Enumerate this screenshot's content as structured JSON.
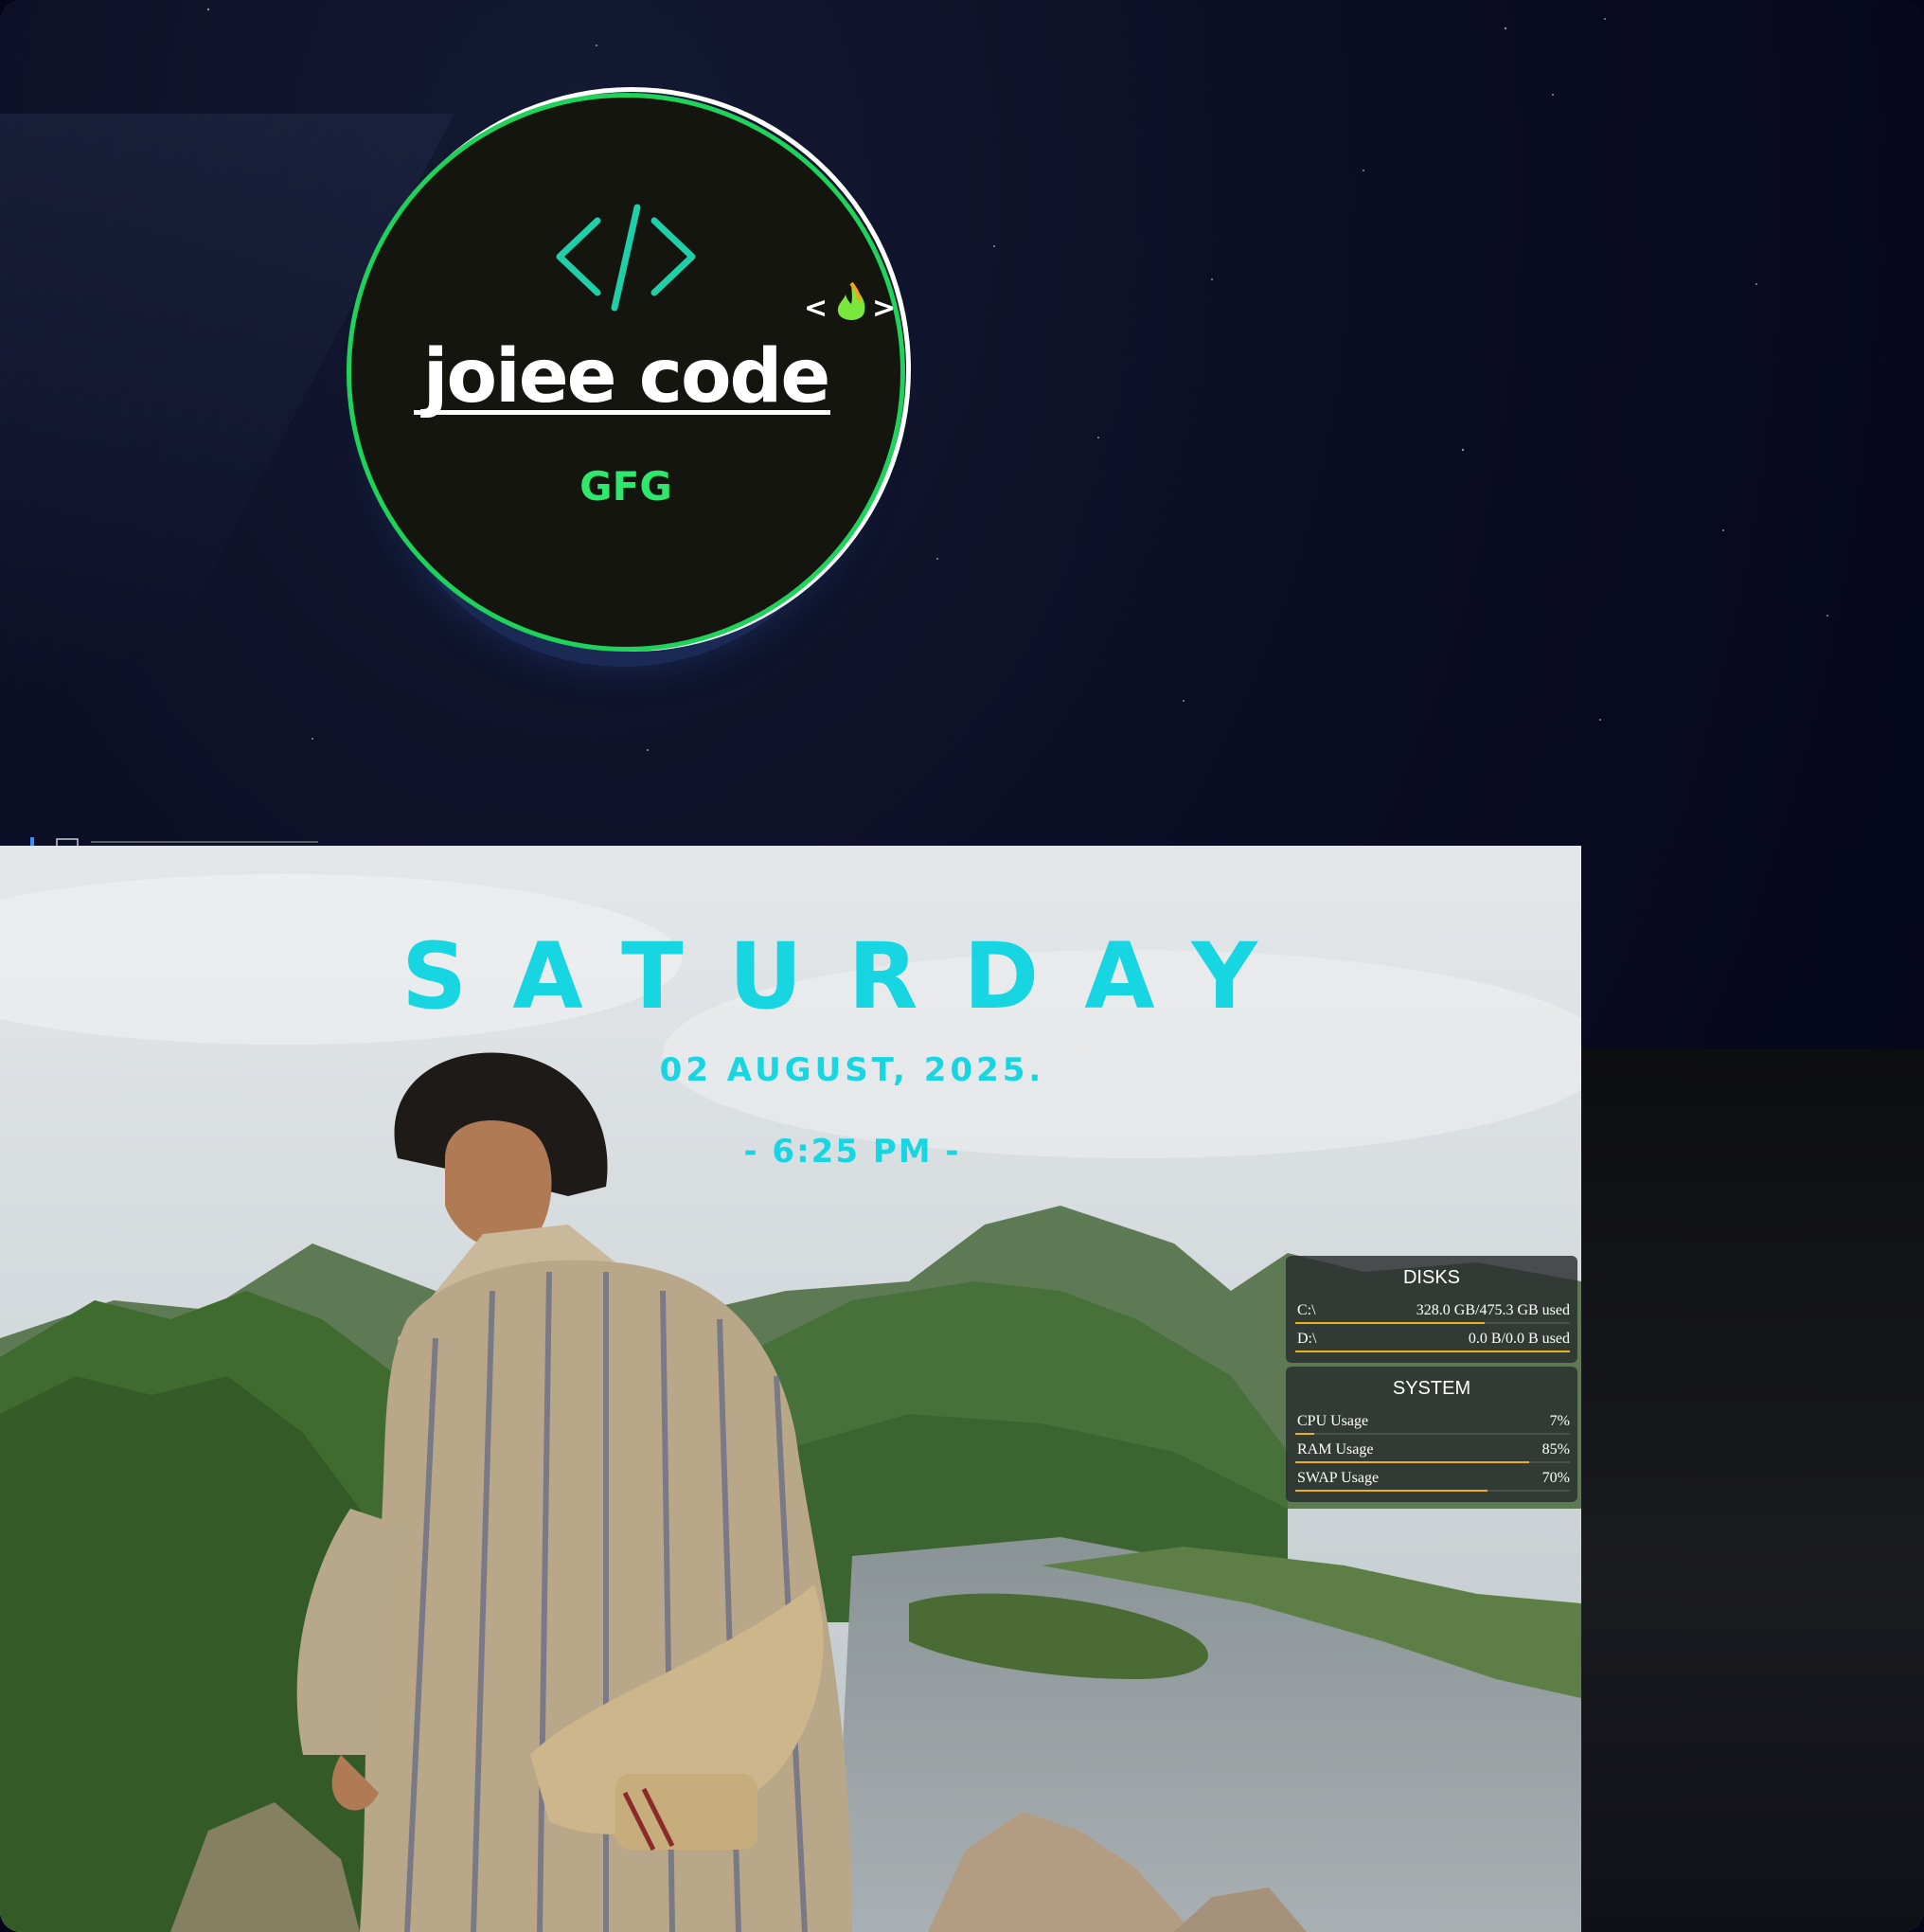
{
  "logo": {
    "brand": "joiee code",
    "subtitle": "GFG",
    "ring_color": "#1fd35a",
    "code_icon": "code-brackets-icon",
    "fire_icon": "fire-icon"
  },
  "clock": {
    "day": "SATURDAY",
    "date": "02 AUGUST, 2025.",
    "time": "- 6:25 PM -",
    "accent": "#18d5e2"
  },
  "disks": {
    "title": "DISKS",
    "rows": [
      {
        "label": "C:\\",
        "value": "328.0 GB/475.3 GB used",
        "fraction": 0.69
      },
      {
        "label": "D:\\",
        "value": "0.0 B/0.0 B used",
        "fraction": 1.0
      }
    ]
  },
  "system": {
    "title": "SYSTEM",
    "rows": [
      {
        "label": "CPU Usage",
        "value": "7%",
        "fraction": 0.07
      },
      {
        "label": "RAM Usage",
        "value": "85%",
        "fraction": 0.85
      },
      {
        "label": "SWAP Usage",
        "value": "70%",
        "fraction": 0.7
      }
    ]
  },
  "bar_color": "#e9b21c"
}
